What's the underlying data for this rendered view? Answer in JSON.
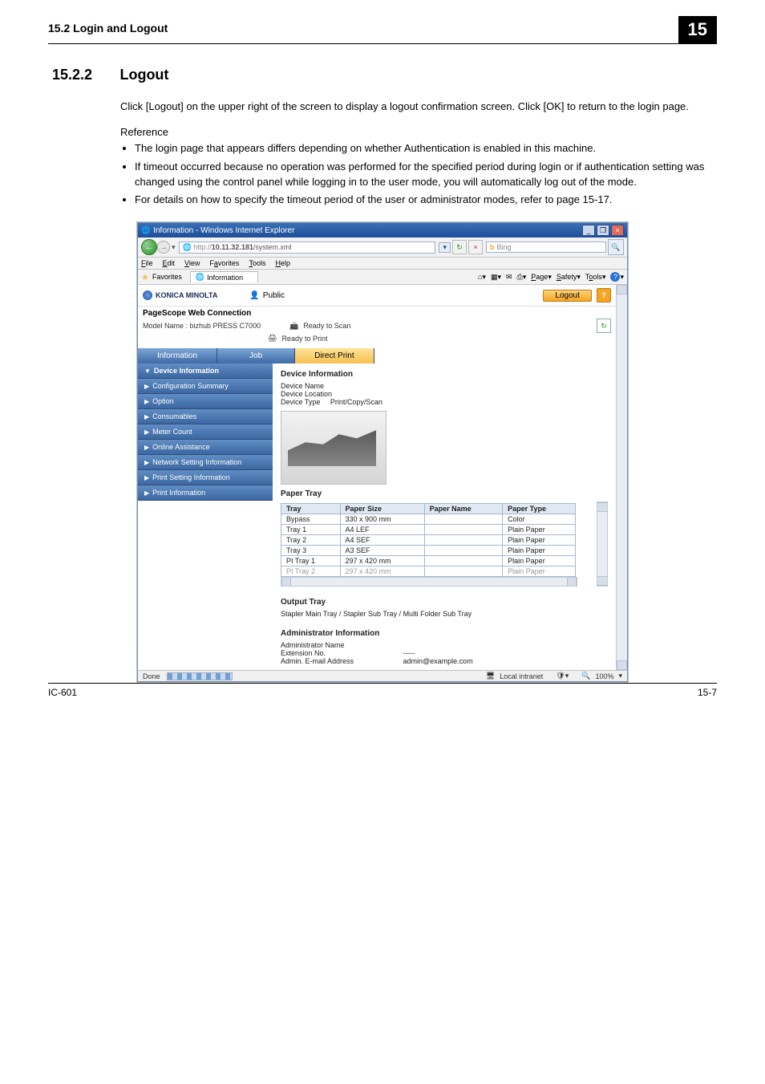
{
  "running_head": {
    "left": "15.2   Login and Logout",
    "chapter": "15"
  },
  "section": {
    "number": "15.2.2",
    "title": "Logout"
  },
  "body": "Click [Logout] on the upper right of the screen to display a logout confirmation screen. Click [OK] to return to the login page.",
  "reference_label": "Reference",
  "ref_bullets": [
    "The login page that appears differs depending on whether Authentication is enabled in this machine.",
    "If timeout occurred because no operation was performed for the specified period during login or if authentication setting was changed using the control panel while logging in to the user mode, you will automatically log out of the mode.",
    "For details on how to specify the timeout period of the user or administrator modes, refer to page 15-17."
  ],
  "shot": {
    "window_title": "Information - Windows Internet Explorer",
    "titlebar_min": "_",
    "titlebar_max": "❐",
    "titlebar_close": "×",
    "url_prefix": "http://",
    "url_host": "10.11.32.181",
    "url_path": "/system.xml",
    "refresh_glyph": "↻",
    "stop_glyph": "×",
    "bing_glyph": "b",
    "bing_label": "Bing",
    "magnify_glyph": "🔍",
    "menu": {
      "file": "File",
      "edit": "Edit",
      "view": "View",
      "favorites": "Favorites",
      "tools": "Tools",
      "help": "Help"
    },
    "favorites_label": "Favorites",
    "tab_title": "Information",
    "cmdbar": {
      "home": "⌂",
      "feeds": "▦",
      "mail": "✉",
      "print": "⎙",
      "page": "Page",
      "safety": "Safety",
      "tools": "Tools",
      "help": "?",
      "chev": "▾"
    },
    "brand": "KONICA MINOLTA",
    "public_label": "Public",
    "logout_label": "Logout",
    "help_label": "?",
    "pagescope": "PageScope Web Connection",
    "status1": "Ready to Scan",
    "status2": "Ready to Print",
    "model_label": "Model Name : bizhub PRESS C7000",
    "tabs": {
      "information": "Information",
      "job": "Job",
      "direct_print": "Direct Print"
    },
    "sidebar": {
      "device_information": "Device Information",
      "configuration_summary": "Configuration Summary",
      "option": "Option",
      "consumables": "Consumables",
      "meter_count": "Meter Count",
      "online_assistance": "Online Assistance",
      "network_setting": "Network Setting Information",
      "print_setting": "Print Setting Information",
      "print_information": "Print Information"
    },
    "main": {
      "h_devinfo": "Device Information",
      "dev_name_label": "Device Name",
      "dev_loc_label": "Device Location",
      "dev_type_label": "Device Type",
      "dev_type_value": "Print/Copy/Scan",
      "h_paper": "Paper Tray",
      "th_tray": "Tray",
      "th_size": "Paper Size",
      "th_name": "Paper Name",
      "th_type": "Paper Type",
      "rows": [
        {
          "tray": "Bypass",
          "size": "330 x 900 mm",
          "name": "",
          "type": "Color"
        },
        {
          "tray": "Tray 1",
          "size": "A4 LEF",
          "name": "",
          "type": "Plain Paper"
        },
        {
          "tray": "Tray 2",
          "size": "A4 SEF",
          "name": "",
          "type": "Plain Paper"
        },
        {
          "tray": "Tray 3",
          "size": "A3 SEF",
          "name": "",
          "type": "Plain Paper"
        },
        {
          "tray": "PI Tray 1",
          "size": "297 x 420 mm",
          "name": "",
          "type": "Plain Paper"
        },
        {
          "tray": "PI Tray 2",
          "size": "297 x 420 mm",
          "name": "",
          "type": "Plain Paper"
        }
      ],
      "h_output": "Output Tray",
      "output_text": "Stapler Main Tray / Stapler Sub Tray / Multi Folder Sub Tray",
      "h_admin": "Administrator Information",
      "admin_name_label": "Administrator Name",
      "admin_ext_label": "Extension No.",
      "admin_ext_value": "-----",
      "admin_email_label": "Admin. E-mail Address",
      "admin_email_value": "admin@example.com"
    },
    "statusbar": {
      "done": "Done",
      "zone": "Local intranet",
      "protected": "",
      "zoom": "100%",
      "zoom_chev": "▾"
    }
  },
  "footer": {
    "product": "IC-601",
    "page": "15-7"
  }
}
